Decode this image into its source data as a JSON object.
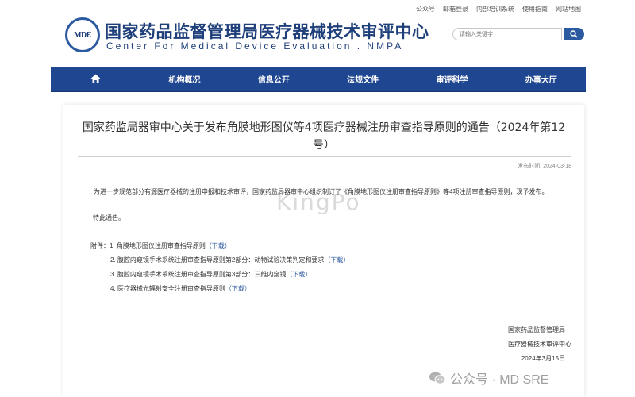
{
  "topbar": {
    "links": [
      "公众号",
      "邮箱登录",
      "内部培训系统",
      "使用指南",
      "网站地图"
    ]
  },
  "header": {
    "logo_text": "MDE",
    "org_name_cn": "国家药品监督管理局医疗器械技术审评中心",
    "org_name_en": "Center For Medical Device Evaluation . NMPA"
  },
  "search": {
    "placeholder": "请输入关键字"
  },
  "nav": {
    "items": [
      "机构概况",
      "信息公开",
      "法规文件",
      "审评科学",
      "办事大厅"
    ]
  },
  "article": {
    "title": "国家药监局器审中心关于发布角膜地形图仪等4项医疗器械注册审查指导原则的通告（2024年第12号）",
    "date_label": "发布时间:",
    "date": "2024-03-18",
    "paragraph1": "为进一步规范部分有源医疗器械的注册申报和技术审评，国家药监局器审中心组织制订了《角膜地形图仪注册审查指导原则》等4项注册审查指导原则，现予发布。",
    "paragraph2": "特此通告。",
    "attachments_label": "附件：",
    "attachments": [
      {
        "text": "1. 角膜地形图仪注册审查指导原则",
        "link": "（下载）"
      },
      {
        "text": "2. 腹腔内窥镜手术系统注册审查指导原则第2部分：动物试验决策判定和要求",
        "link": "（下载）"
      },
      {
        "text": "3. 腹腔内窥镜手术系统注册审查指导原则第3部分：三维内窥镜",
        "link": "（下载）"
      },
      {
        "text": "4. 医疗器械光辐射安全注册审查指导原则",
        "link": "（下载）"
      }
    ],
    "signature": [
      "国家药品监督管理局",
      "医疗器械技术审评中心",
      "2024年3月15日"
    ]
  },
  "watermark": "KingPo",
  "footer_watermark": "公众号 · MD SRE",
  "colors": {
    "nav_bg": "#1f4690",
    "brand_blue": "#1e3f7a",
    "link": "#2c5aa0"
  }
}
